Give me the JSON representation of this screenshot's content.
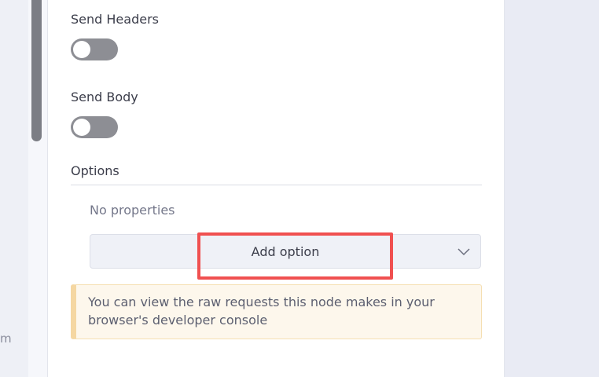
{
  "sidebar": {
    "fragment_text": "m"
  },
  "form": {
    "send_headers": {
      "label": "Send Headers",
      "enabled": false
    },
    "send_body": {
      "label": "Send Body",
      "enabled": false
    },
    "options": {
      "title": "Options",
      "empty_text": "No properties",
      "add_button_label": "Add option"
    },
    "notice": {
      "text": "You can view the raw requests this node makes in your browser's developer console"
    }
  },
  "colors": {
    "highlight": "#f05050",
    "toggle_off": "#8d8e94",
    "notice_accent": "#f5d7a2"
  },
  "icons": {
    "dropdown": "chevron-down-icon"
  }
}
